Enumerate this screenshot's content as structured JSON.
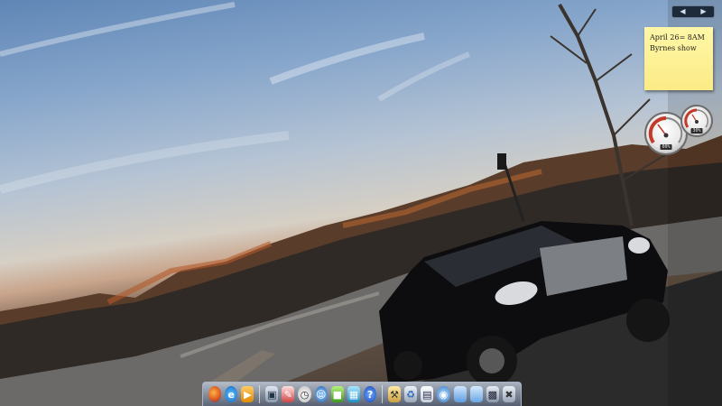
{
  "desktop": {
    "wallpaper": "lake-sunset-truck",
    "colors": {
      "sky": "#7f9ec5",
      "dock": "#8a96a8",
      "note": "#fbeb86"
    }
  },
  "sticky_note": {
    "lines": [
      "April 26= 8AM",
      "Byrnes show"
    ]
  },
  "gadgets": {
    "cpu_meter": {
      "readout": "00%",
      "value": 0.3
    },
    "memory_meter": {
      "readout": "30%",
      "value": 0.3
    }
  },
  "sidebar_button": {
    "icons": [
      "prev-icon",
      "next-icon"
    ]
  },
  "dock": {
    "icons": [
      "firefox-icon",
      "internet-explorer-icon",
      "media-player-icon",
      "network-icon",
      "paint-icon",
      "clock-icon",
      "messenger-icon",
      "green-app-icon",
      "remote-desktop-icon",
      "help-icon",
      "tools-icon",
      "recycle-bin-icon",
      "document-icon",
      "globe-icon",
      "folder-icon",
      "folder-open-icon",
      "computer-icon",
      "close-folder-icon"
    ]
  }
}
